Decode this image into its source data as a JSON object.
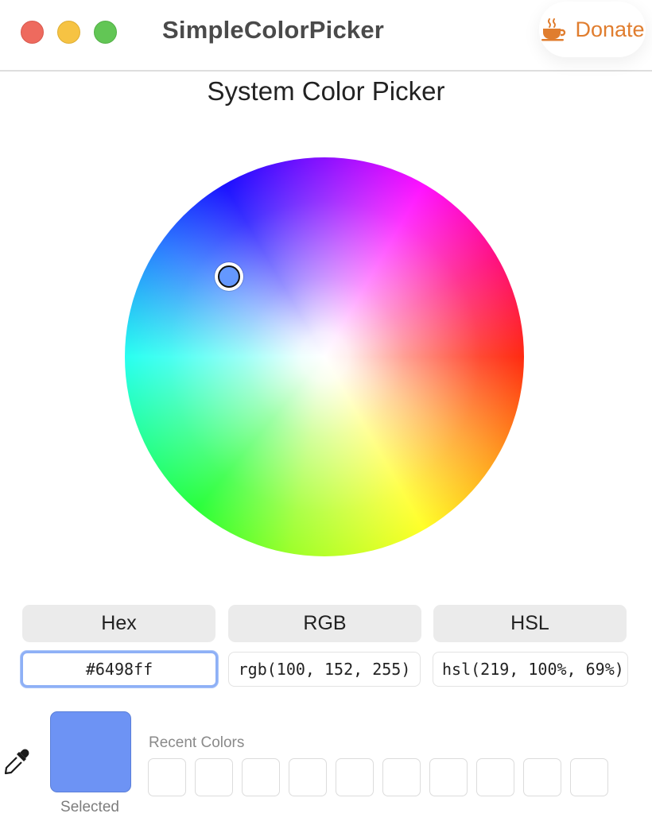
{
  "window": {
    "title": "SimpleColorPicker",
    "traffic_lights": [
      "close",
      "minimize",
      "zoom"
    ]
  },
  "donate": {
    "label": "Donate",
    "icon": "coffee-cup-icon",
    "color": "#e07d2e"
  },
  "picker": {
    "title": "System Color Picker",
    "selected_color": "#6498ff",
    "formats": [
      {
        "label": "Hex",
        "value": "#6498ff"
      },
      {
        "label": "RGB",
        "value": "rgb(100, 152, 255)"
      },
      {
        "label": "HSL",
        "value": "hsl(219, 100%, 69%)"
      }
    ]
  },
  "selected": {
    "label": "Selected",
    "swatch_color": "#6d93f4"
  },
  "recent": {
    "label": "Recent Colors",
    "slot_count": 10,
    "colors": []
  },
  "icons": {
    "eyedropper": "eyedropper-icon"
  }
}
